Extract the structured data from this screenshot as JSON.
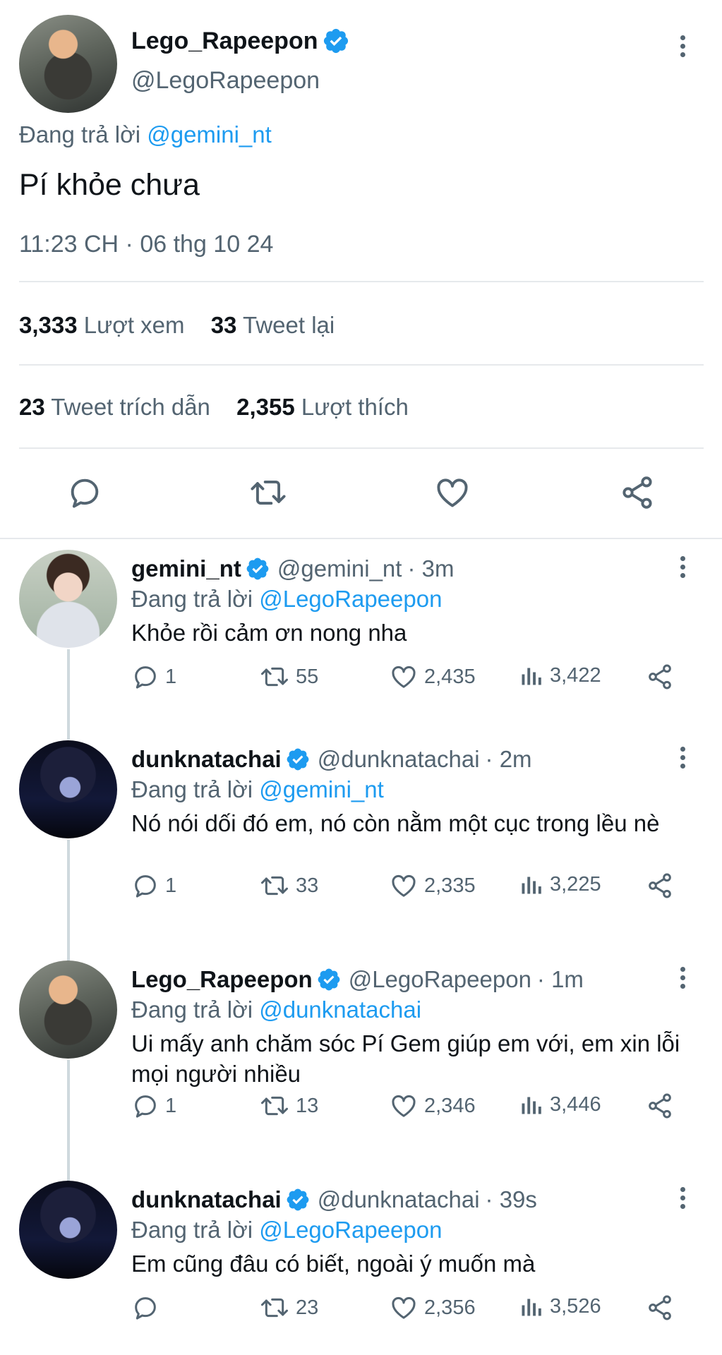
{
  "main_tweet": {
    "display_name": "Lego_Rapeepon",
    "handle": "@LegoRapeepon",
    "replying_label": "Đang trả lời",
    "replying_to": "@gemini_nt",
    "text": "Pí khỏe chưa",
    "timestamp": "11:23 CH · 06 thg 10 24",
    "stats": {
      "views_count": "3,333",
      "views_label": "Lượt xem",
      "retweets_count": "33",
      "retweets_label": "Tweet lại",
      "quotes_count": "23",
      "quotes_label": "Tweet trích dẫn",
      "likes_count": "2,355",
      "likes_label": "Lượt thích"
    }
  },
  "replies": [
    {
      "display_name": "gemini_nt",
      "handle": "@gemini_nt",
      "time": "· 3m",
      "replying_label": "Đang trả lời",
      "replying_to": "@LegoRapeepon",
      "text": "Khỏe rồi cảm ơn nong nha",
      "replies": "1",
      "retweets": "55",
      "likes": "2,435",
      "views": "3,422"
    },
    {
      "display_name": "dunknatachai",
      "handle": "@dunknatachai",
      "time": "· 2m",
      "replying_label": "Đang trả lời",
      "replying_to": "@gemini_nt",
      "text": "Nó nói dối đó em, nó còn nằm một cục trong lều nè",
      "replies": "1",
      "retweets": "33",
      "likes": "2,335",
      "views": "3,225"
    },
    {
      "display_name": "Lego_Rapeepon",
      "handle": "@LegoRapeepon",
      "time": "· 1m",
      "replying_label": "Đang trả lời",
      "replying_to": "@dunknatachai",
      "text": "Ui mấy anh chăm sóc Pí Gem giúp em với, em xin lỗi mọi người nhiều",
      "replies": "1",
      "retweets": "13",
      "likes": "2,346",
      "views": "3,446"
    },
    {
      "display_name": "dunknatachai",
      "handle": "@dunknatachai",
      "time": "· 39s",
      "replying_label": "Đang trả lời",
      "replying_to": "@LegoRapeepon",
      "text": "Em cũng đâu có biết, ngoài ý muốn mà",
      "replies": "",
      "retweets": "23",
      "likes": "2,356",
      "views": "3,526"
    }
  ],
  "colors": {
    "accent": "#1d9bf0",
    "text": "#0f1419",
    "secondary": "#536471",
    "divider": "#e6e9ec"
  },
  "icons": [
    "verified-badge-icon",
    "more-icon",
    "reply-icon",
    "retweet-icon",
    "like-icon",
    "share-icon",
    "views-icon"
  ]
}
